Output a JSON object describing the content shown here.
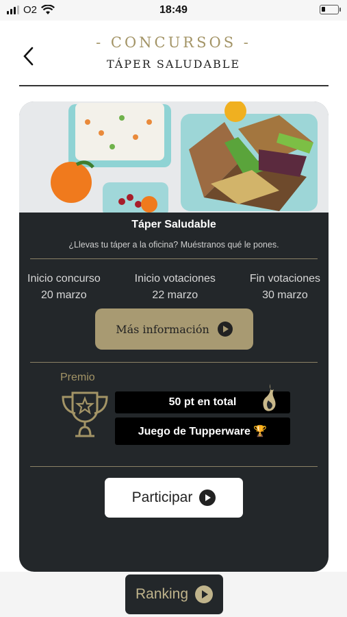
{
  "status": {
    "carrier": "O2",
    "time": "18:49"
  },
  "header": {
    "title": "- CONCURSOS -",
    "subtitle": "TÁPER SALUDABLE"
  },
  "contest": {
    "name": "Táper Saludable",
    "description": "¿Llevas tu táper a la oficina? Muéstranos qué le pones.",
    "dates": [
      {
        "label": "Inicio concurso",
        "value": "20 marzo"
      },
      {
        "label": "Inicio votaciones",
        "value": "22 marzo"
      },
      {
        "label": "Fin votaciones",
        "value": "30 marzo"
      }
    ],
    "more_info_label": "Más información"
  },
  "prize": {
    "label": "Premio",
    "points": "50 pt en total",
    "item": "Juego de Tupperware 🏆"
  },
  "actions": {
    "participate_label": "Participar",
    "ranking_label": "Ranking"
  },
  "colors": {
    "gold": "#a39466",
    "card_bg": "#23272a",
    "button_gold": "#a89a72"
  }
}
